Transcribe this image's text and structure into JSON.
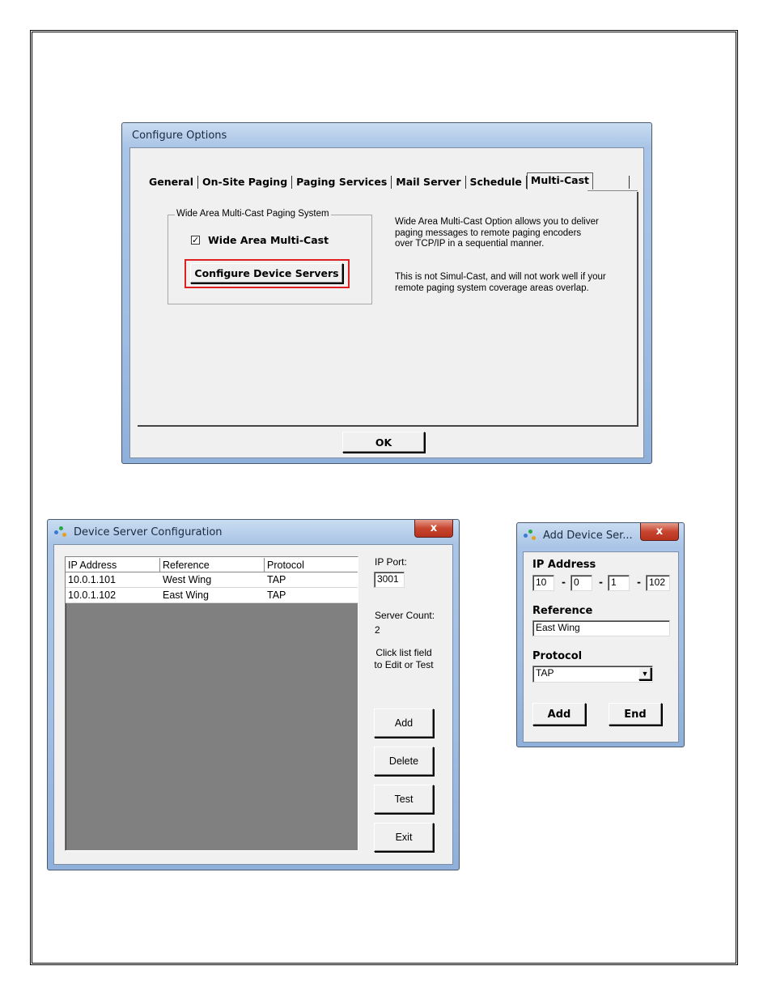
{
  "configure_options": {
    "title": "Configure Options",
    "tabs": [
      "General",
      "On-Site Paging",
      "Paging Services",
      "Mail Server",
      "Schedule",
      "Multi-Cast"
    ],
    "active_tab": "Multi-Cast",
    "group_title": "Wide Area Multi-Cast Paging System",
    "checkbox_label": "Wide Area Multi-Cast",
    "checkbox_checked": true,
    "configure_button": "Configure Device Servers",
    "description_1": "Wide Area Multi-Cast Option allows you to deliver paging messages to remote paging encoders over TCP/IP in a sequential manner.",
    "description_2": "This is not Simul-Cast, and will not work well if your remote paging system coverage areas overlap.",
    "ok_button": "OK",
    "highlight_color": "#e02020"
  },
  "device_server_config": {
    "title": "Device Server Configuration",
    "close_label": "x",
    "columns": [
      "IP Address",
      "Reference",
      "Protocol"
    ],
    "rows": [
      [
        "10.0.1.101",
        "West Wing",
        "TAP"
      ],
      [
        "10.0.1.102",
        "East Wing",
        "TAP"
      ]
    ],
    "ip_port_label": "IP Port:",
    "ip_port_value": "3001",
    "server_count_label": "Server Count:",
    "server_count_value": "2",
    "hint": "Click list field to Edit or Test",
    "buttons": {
      "add": "Add",
      "delete": "Delete",
      "test": "Test",
      "exit": "Exit"
    }
  },
  "add_device_server": {
    "title": "Add Device Ser...",
    "close_label": "x",
    "ip_label": "IP Address",
    "ip_octets": [
      "10",
      "0",
      "1",
      "102"
    ],
    "reference_label": "Reference",
    "reference_value": "East Wing",
    "protocol_label": "Protocol",
    "protocol_value": "TAP",
    "buttons": {
      "add": "Add",
      "end": "End"
    }
  }
}
